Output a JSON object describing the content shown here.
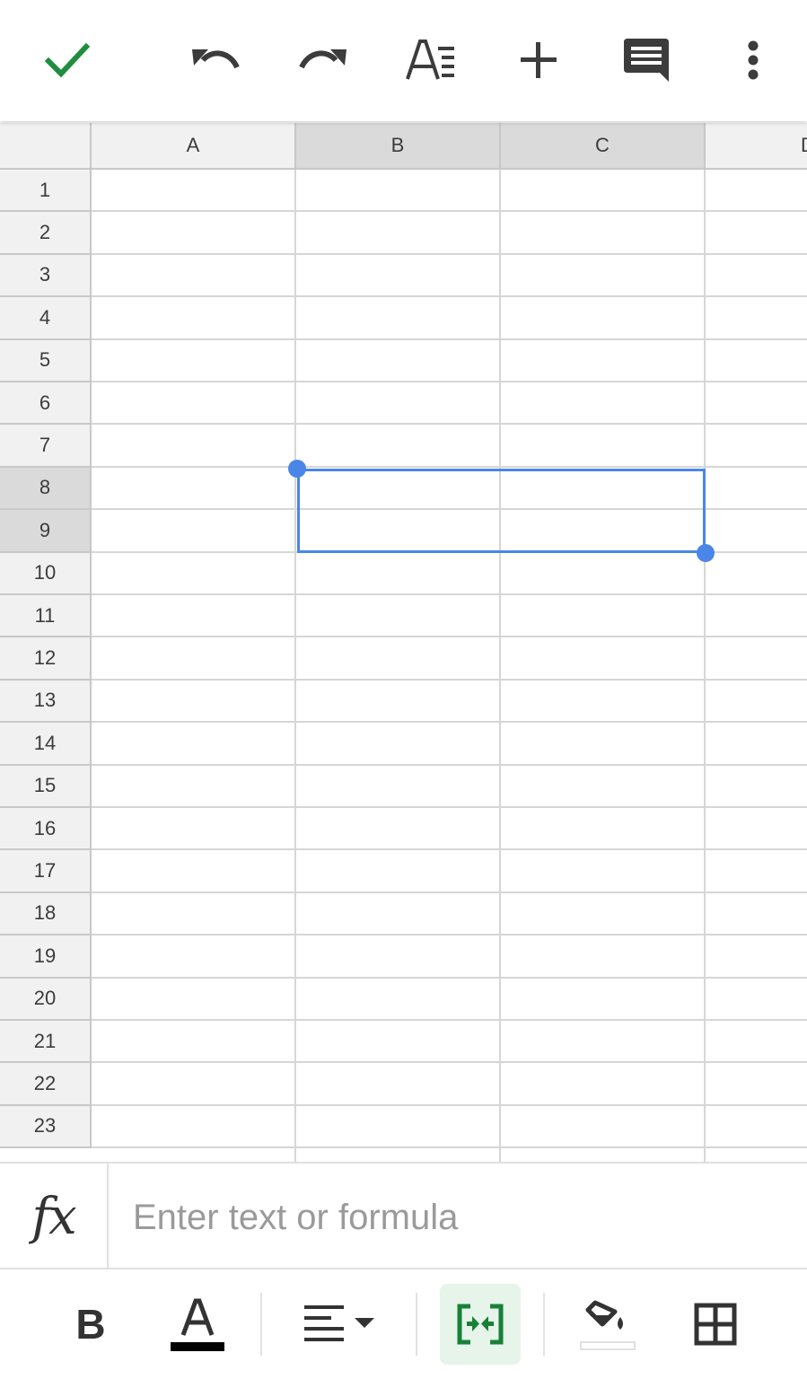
{
  "toolbar": {
    "icons": [
      "check-icon",
      "undo-icon",
      "redo-icon",
      "text-format-icon",
      "plus-icon",
      "comment-icon",
      "more-vert-icon"
    ]
  },
  "grid": {
    "columns": [
      "A",
      "B",
      "C",
      "D"
    ],
    "rows": [
      "1",
      "2",
      "3",
      "4",
      "5",
      "6",
      "7",
      "8",
      "9",
      "10",
      "11",
      "12",
      "13",
      "14",
      "15",
      "16",
      "17",
      "18",
      "19",
      "20",
      "21",
      "22",
      "23"
    ],
    "selected_columns": [
      "B",
      "C"
    ],
    "selected_rows": [
      "8",
      "9"
    ],
    "selection_color": "#4a86e8"
  },
  "formula_bar": {
    "fx_label": "fx",
    "placeholder": "Enter text or formula",
    "value": ""
  },
  "format_bar": {
    "icons": [
      "bold-icon",
      "text-color-icon",
      "align-left-icon",
      "merge-cells-icon",
      "fill-color-icon",
      "borders-icon"
    ],
    "bold_label": "B",
    "text_color": "#000000",
    "merge_active_color": "#188038"
  }
}
